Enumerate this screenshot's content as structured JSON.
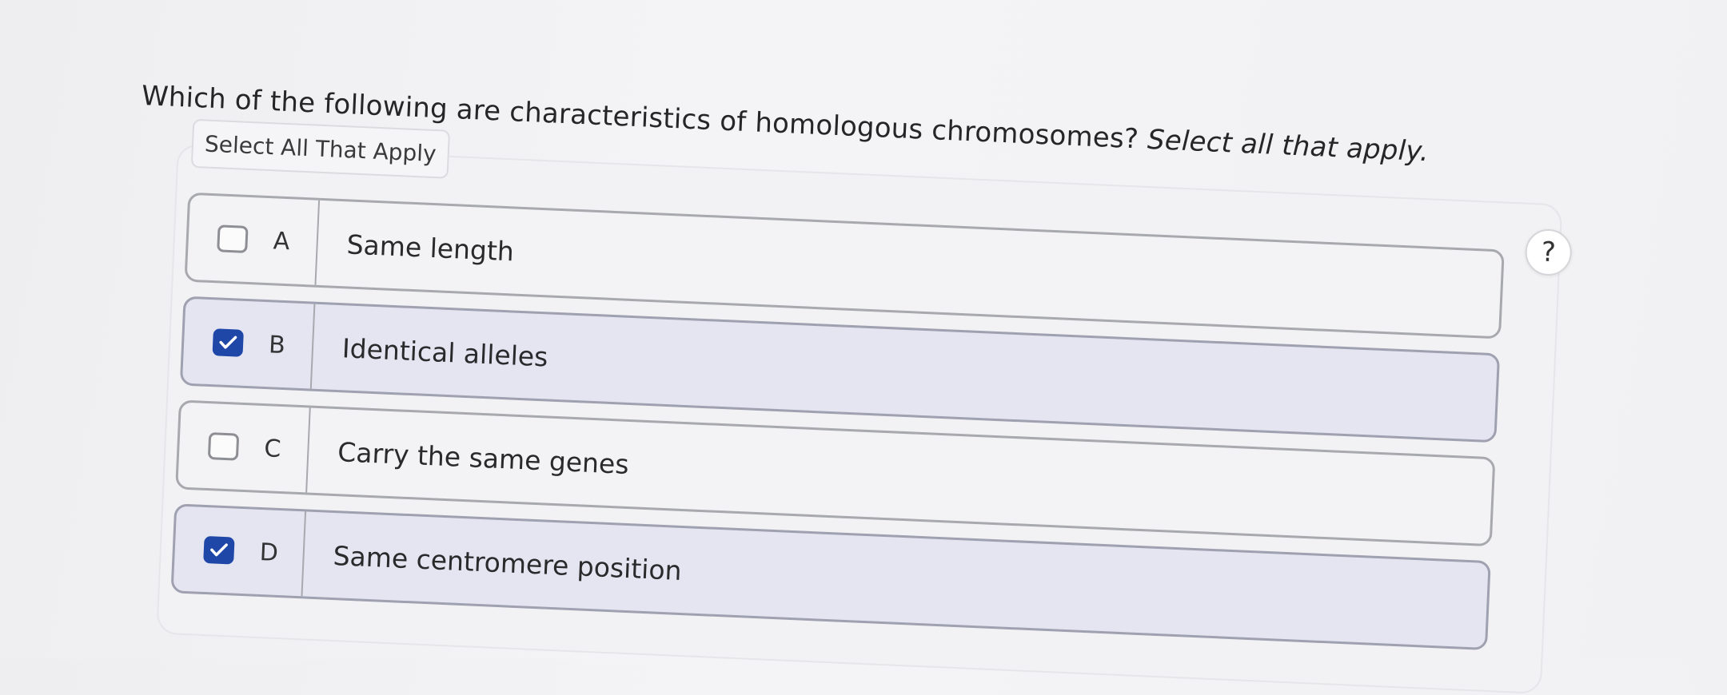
{
  "question": {
    "text": "Which of the following are characteristics of homologous chromosomes?",
    "hint": "Select all that apply."
  },
  "panel": {
    "select_label": "Select All That Apply",
    "help_symbol": "?"
  },
  "options": [
    {
      "letter": "A",
      "text": "Same length",
      "checked": false
    },
    {
      "letter": "B",
      "text": "Identical alleles",
      "checked": true
    },
    {
      "letter": "C",
      "text": "Carry the same genes",
      "checked": false
    },
    {
      "letter": "D",
      "text": "Same centromere position",
      "checked": true
    }
  ],
  "colors": {
    "accent": "#1f47a8",
    "selected_background": "#e4e5f1",
    "option_border": "#a8a9ae"
  },
  "icons": {
    "help": "question-mark-icon",
    "check": "checkmark-icon"
  }
}
